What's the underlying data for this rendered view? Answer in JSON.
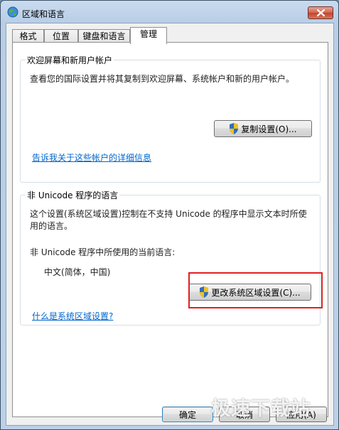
{
  "window": {
    "title": "区域和语言"
  },
  "tabs": [
    {
      "label": "格式"
    },
    {
      "label": "位置"
    },
    {
      "label": "键盘和语言"
    },
    {
      "label": "管理"
    }
  ],
  "welcome_group": {
    "label": "欢迎屏幕和新用户帐户",
    "description": "查看您的国际设置并将其复制到欢迎屏幕、系统帐户和新的用户帐户。",
    "copy_button": "复制设置(O)...",
    "link": "告诉我关于这些帐户的详细信息"
  },
  "unicode_group": {
    "label": "非 Unicode 程序的语言",
    "description_line1": "这个设置(系统区域设置)控制在不支持 Unicode 的程序中显示文本时所使",
    "description_line2": "用的语言。",
    "current_label": "非 Unicode 程序中所使用的当前语言:",
    "current_value": "中文(简体，中国)",
    "change_button": "更改系统区域设置(C)...",
    "link": "什么是系统区域设置?"
  },
  "footer": {
    "ok_button": "确定",
    "cancel_button": "取消",
    "apply_button": "应用(A)"
  },
  "watermark": "极速下载站",
  "colors": {
    "link": "#0066cc",
    "highlight_box": "#e02020",
    "title_bar": "#c9dbee"
  }
}
